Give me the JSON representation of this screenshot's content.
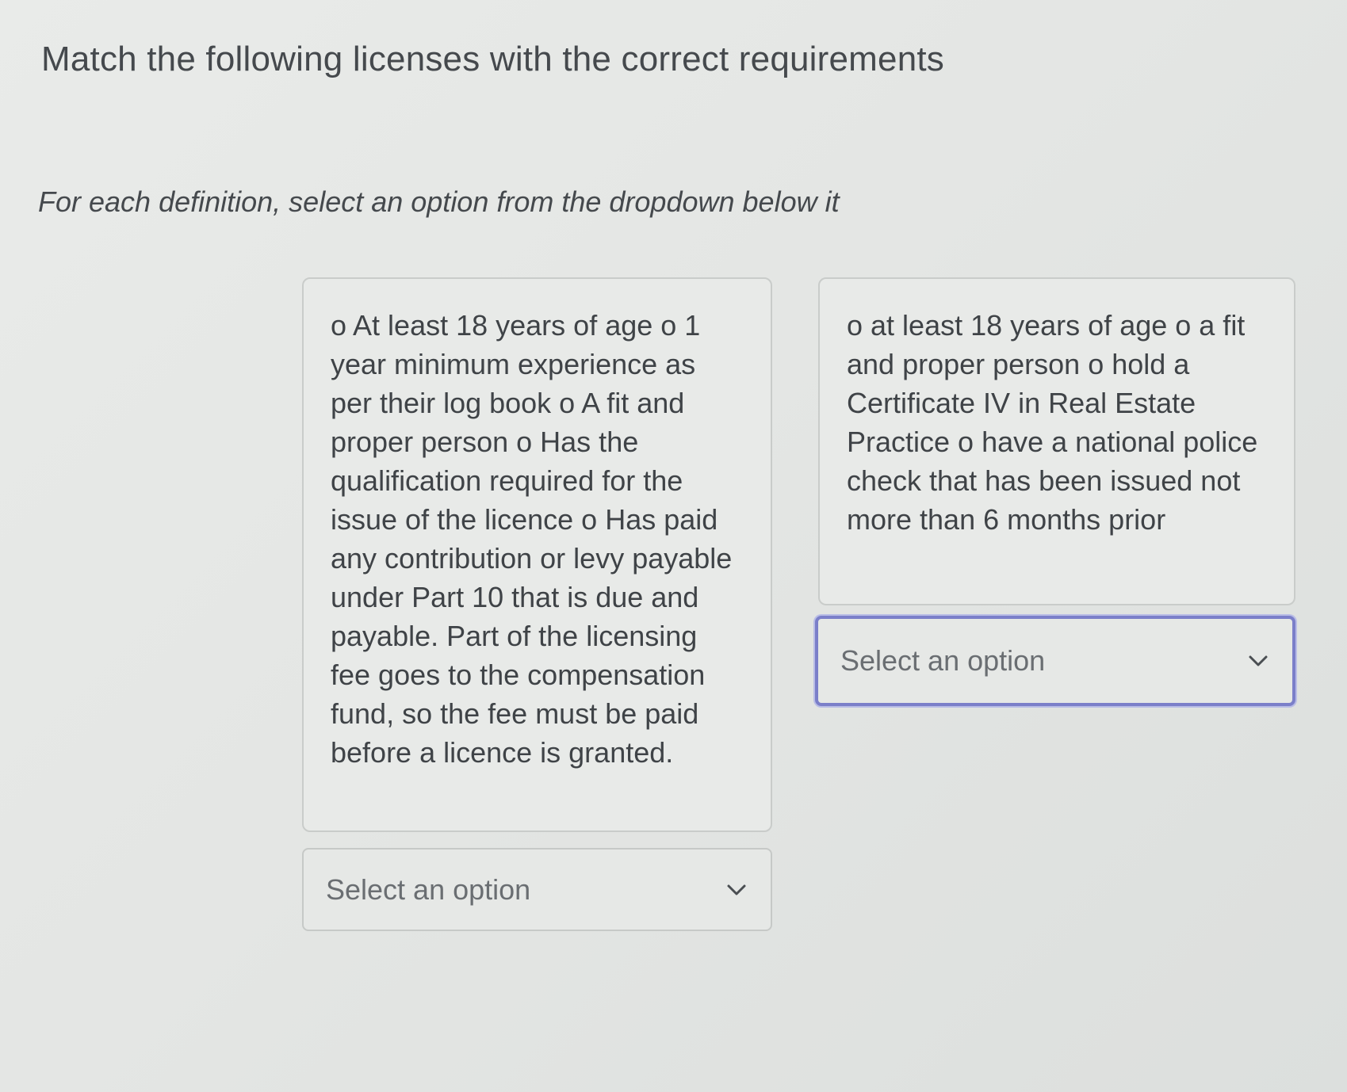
{
  "page": {
    "title": "Match the following licenses with the correct requirements",
    "instruction": "For each definition, select an option from the dropdown below it"
  },
  "definitions": [
    {
      "text": "o At least 18 years of age o 1 year minimum experience as per their log book o A fit and proper person o Has the qualification required for the issue of the licence o Has paid any contribution or levy payable under Part 10 that is due and payable. Part of the licensing fee goes to the compensation fund, so the fee must be paid before a licence is granted.",
      "dropdown": {
        "placeholder": "Select an option",
        "icon": "chevron-down-icon"
      }
    },
    {
      "text": "o at least 18 years of age o a fit and proper person o hold a Certificate IV in Real Estate Practice o have a national police check that has been issued not more than 6 months prior",
      "dropdown": {
        "placeholder": "Select an option",
        "icon": "chevron-down-icon",
        "focused": true
      }
    }
  ],
  "colors": {
    "background": "#e6e8e6",
    "focus_border": "#7b7fc9",
    "text": "#3f4347"
  }
}
